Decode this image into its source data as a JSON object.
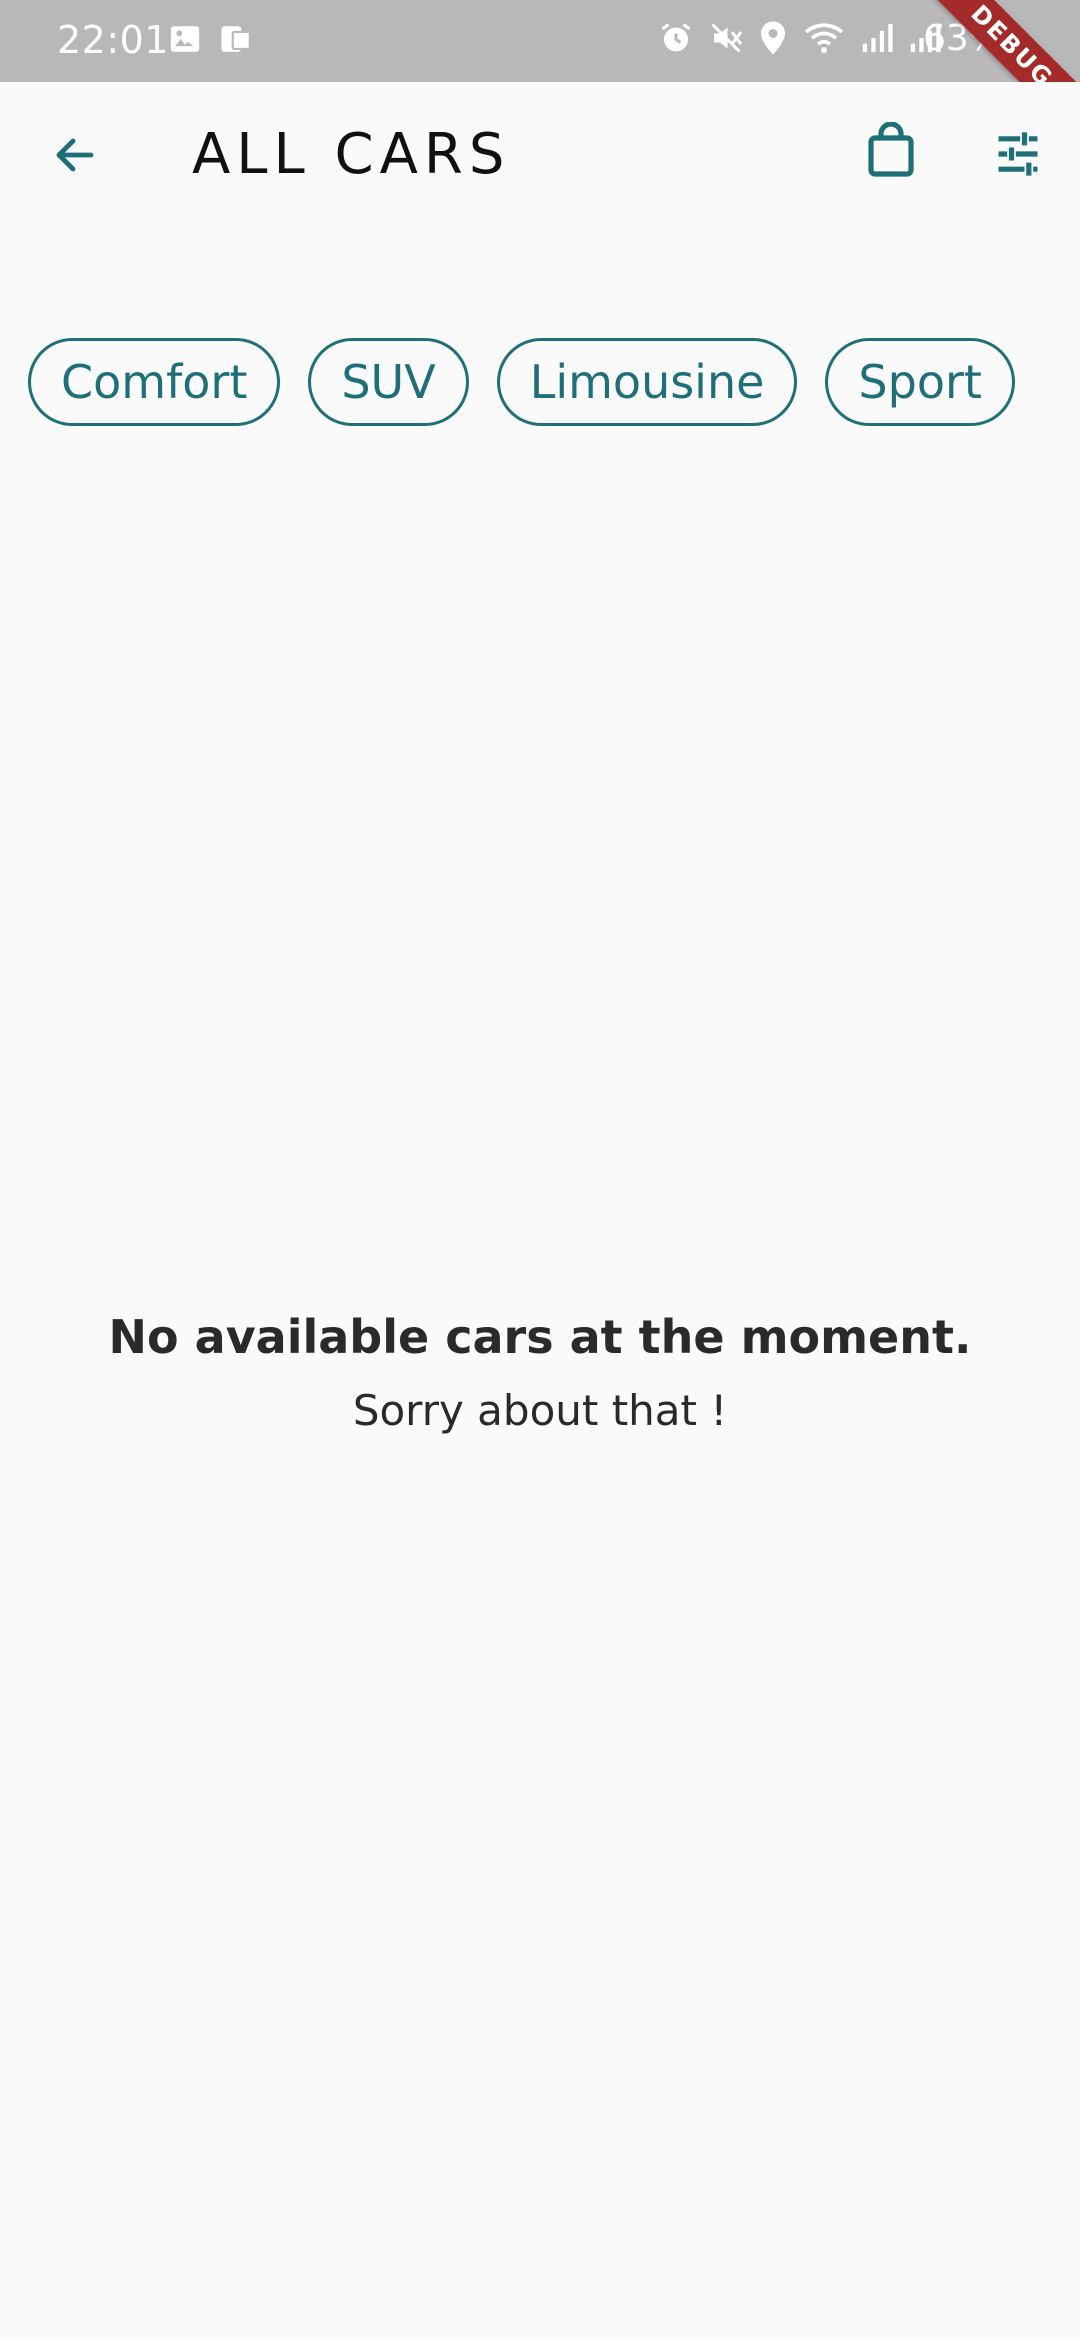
{
  "status_bar": {
    "time": "22:01",
    "battery": "63%",
    "icons_left": [
      "image-icon",
      "cast-icon"
    ],
    "icons_right": [
      "alarm-icon",
      "mute-icon",
      "location-icon",
      "wifi-icon",
      "signal-icon",
      "signal-icon"
    ]
  },
  "debug_banner": "DEBUG",
  "app_bar": {
    "title": "ALL CARS",
    "back_icon": "arrow-left-icon",
    "cart_icon": "shopping-bag-icon",
    "filter_icon": "tune-icon"
  },
  "categories": [
    {
      "label": "Comfort"
    },
    {
      "label": "SUV"
    },
    {
      "label": "Limousine"
    },
    {
      "label": "Sport"
    }
  ],
  "empty_state": {
    "title": "No available cars at the moment.",
    "subtitle": "Sorry about that !"
  },
  "colors": {
    "accent": "#1f6f78",
    "background": "#fafafa",
    "status_bar": "#b8b8b8",
    "debug_ribbon": "#a52a2a"
  }
}
